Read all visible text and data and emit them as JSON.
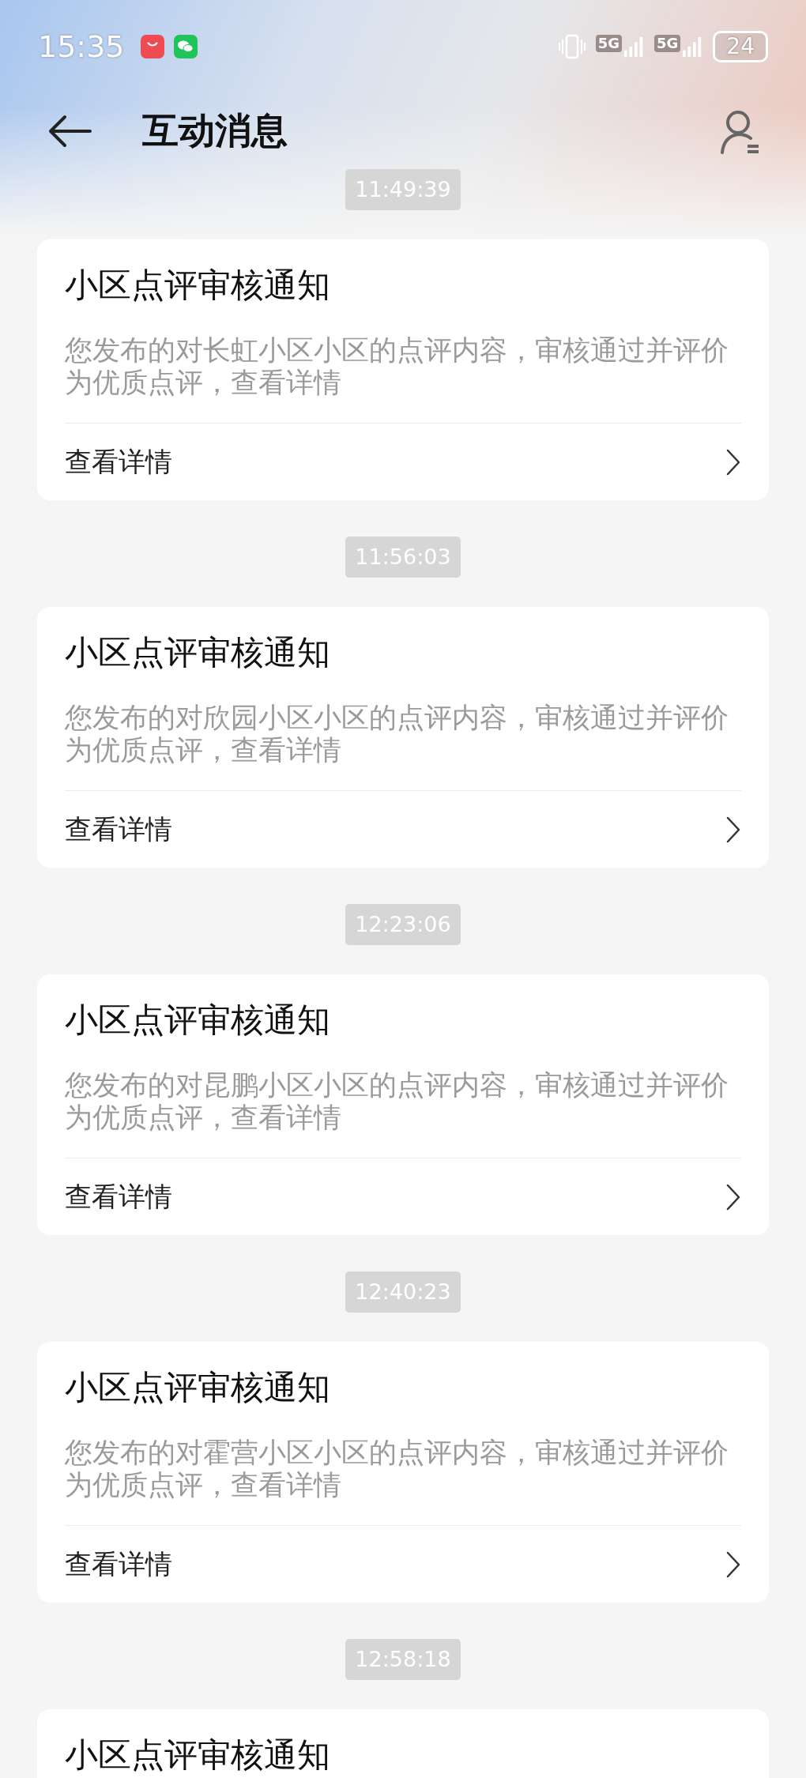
{
  "status_bar": {
    "time": "15:35",
    "signals": [
      {
        "network": "5G"
      },
      {
        "network": "5G"
      }
    ],
    "battery": "24"
  },
  "header": {
    "title": "互动消息"
  },
  "messages": [
    {
      "time": "11:49:39",
      "title": "小区点评审核通知",
      "body": "您发布的对长虹小区小区的点评内容，审核通过并评价为优质点评，查看详情",
      "action": "查看详情"
    },
    {
      "time": "11:56:03",
      "title": "小区点评审核通知",
      "body": "您发布的对欣园小区小区的点评内容，审核通过并评价为优质点评，查看详情",
      "action": "查看详情"
    },
    {
      "time": "12:23:06",
      "title": "小区点评审核通知",
      "body": "您发布的对昆鹏小区小区的点评内容，审核通过并评价为优质点评，查看详情",
      "action": "查看详情"
    },
    {
      "time": "12:40:23",
      "title": "小区点评审核通知",
      "body": "您发布的对霍营小区小区的点评内容，审核通过并评价为优质点评，查看详情",
      "action": "查看详情"
    },
    {
      "time": "12:58:18",
      "title": "小区点评审核通知"
    }
  ]
}
